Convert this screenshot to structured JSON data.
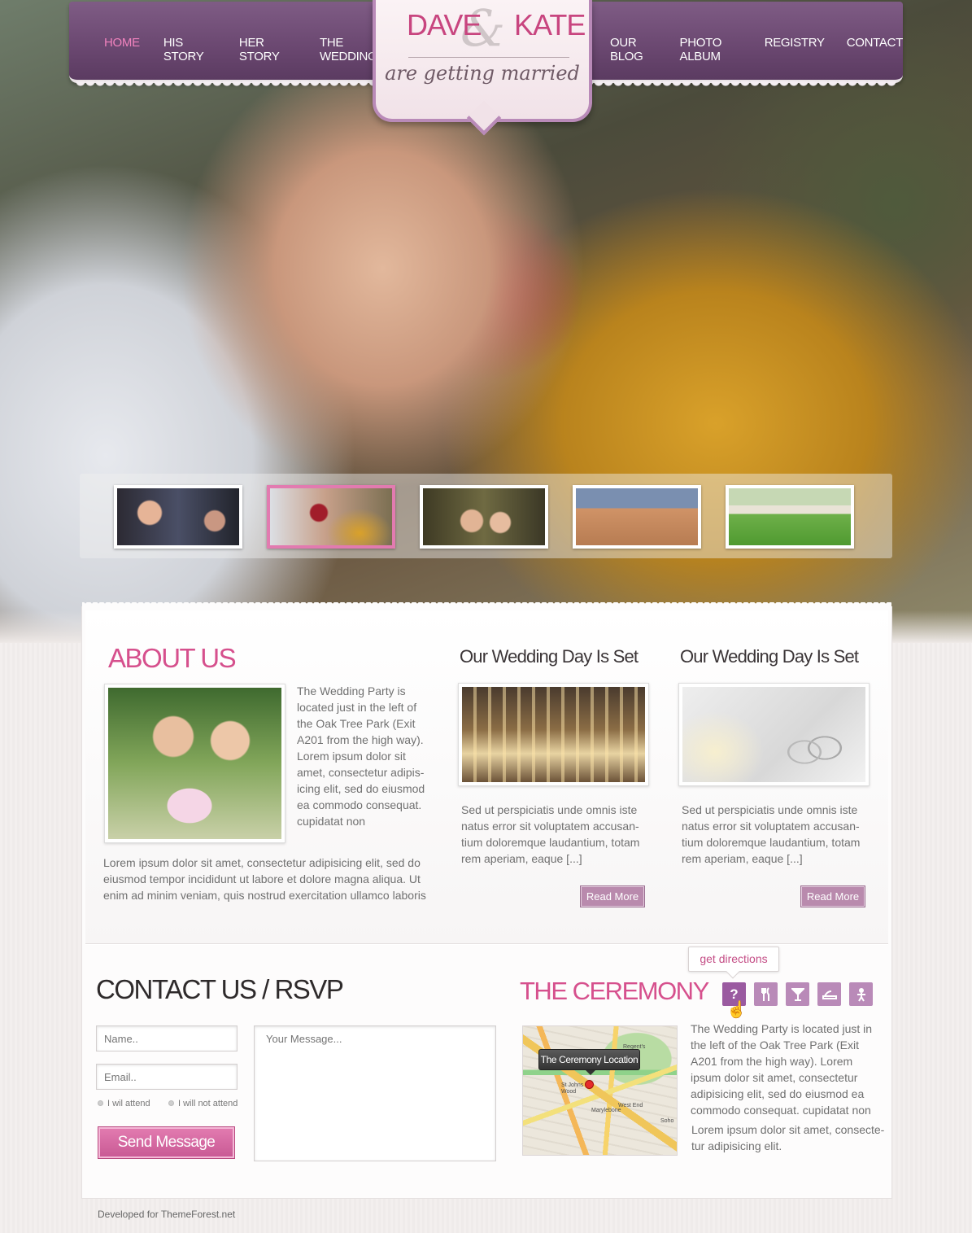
{
  "nav": {
    "left": [
      "HOME",
      "HIS STORY",
      "HER STORY",
      "THE  WEDDING"
    ],
    "right": [
      "OUR BLOG",
      "PHOTO ALBUM",
      "REGISTRY",
      "CONTACT"
    ],
    "active": "HOME"
  },
  "logo": {
    "name1": "DAVE",
    "ampersand": "&",
    "name2": "KATE",
    "tagline": "are getting married"
  },
  "thumbnails": [
    {
      "alt": "party friends",
      "active": false
    },
    {
      "alt": "couple with rose",
      "active": true
    },
    {
      "alt": "fun couple",
      "active": false
    },
    {
      "alt": "beach friends",
      "active": false
    },
    {
      "alt": "couple on lawn",
      "active": false
    }
  ],
  "about": {
    "heading": "ABOUT US",
    "side_text": [
      "The Wedding Party is",
      "located just in the left of",
      "the Oak Tree Park (Exit",
      "A201 from the high way).",
      "Lorem ipsum dolor sit",
      "amet, consectetur adipis-",
      "icing elit, sed do eiusmod",
      "ea commodo consequat.",
      "cupidatat non"
    ],
    "full_text": [
      "Lorem ipsum dolor sit amet, consectetur adipisicing elit, sed do",
      "eiusmod tempor incididunt ut labore et dolore magna aliqua. Ut",
      "enim ad minim veniam, quis nostrud exercitation ullamco laboris"
    ]
  },
  "posts": [
    {
      "title": "Our Wedding Day Is Set",
      "text": [
        "Sed ut perspiciatis unde omnis iste",
        "natus error sit voluptatem accusan-",
        "tium doloremque laudantium, totam",
        "rem aperiam, eaque [...]"
      ],
      "button": "Read More"
    },
    {
      "title": "Our Wedding Day Is Set",
      "text": [
        "Sed ut perspiciatis unde omnis iste",
        "natus error sit voluptatem accusan-",
        "tium doloremque laudantium, totam",
        "rem aperiam, eaque [...]"
      ],
      "button": "Read More"
    }
  ],
  "contact": {
    "heading": "CONTACT US / RSVP",
    "name_placeholder": "Name..",
    "email_placeholder": "Email..",
    "message_placeholder": "Your Message...",
    "attend": "I wil attend",
    "not_attend": "I will not attend",
    "send": "Send Message"
  },
  "ceremony": {
    "heading": "THE CEREMONY",
    "tooltip": "get directions",
    "icons": [
      "question-icon",
      "cutlery-icon",
      "cocktail-icon",
      "shoe-icon",
      "baby-icon"
    ],
    "map_label": "The Ceremony Location",
    "map_places": [
      "Regent's",
      "St Johns",
      "Wood",
      "Marylebone",
      "West End",
      "Soho"
    ],
    "text": [
      "The Wedding Party is located just in",
      "the left of the Oak Tree Park (Exit",
      "A201 from the high way). Lorem",
      "ipsum dolor sit amet, consectetur",
      "adipisicing elit, sed do eiusmod ea",
      "commodo consequat. cupidatat non"
    ],
    "text2": [
      "Lorem ipsum dolor sit amet, consecte-",
      "tur adipisicing elit."
    ]
  },
  "footer": {
    "credit": "Developed for ThemeForest.net"
  },
  "colors": {
    "accent_pink": "#d6508d",
    "nav_purple": "#6a4770",
    "button_mauve": "#b98aad"
  }
}
